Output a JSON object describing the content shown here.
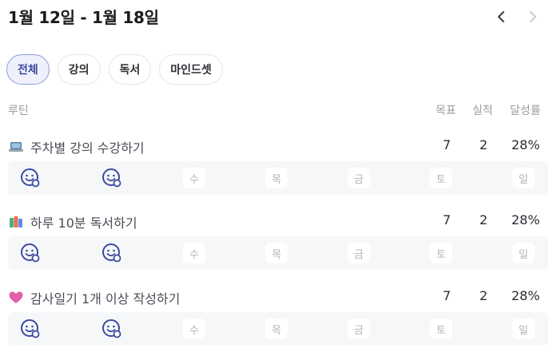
{
  "header": {
    "title": "1월 12일 - 1월 18일"
  },
  "filters": [
    {
      "label": "전체",
      "active": true
    },
    {
      "label": "강의",
      "active": false
    },
    {
      "label": "독서",
      "active": false
    },
    {
      "label": "마인드셋",
      "active": false
    }
  ],
  "columns": {
    "routine": "루틴",
    "goal": "목표",
    "actual": "실적",
    "rate": "달성률"
  },
  "accent_color": "#3b4aa0",
  "routines": [
    {
      "icon": "laptop-icon",
      "name": "주차별 강의 수강하기",
      "goal": "7",
      "actual": "2",
      "rate": "28%",
      "days": [
        "",
        "",
        "수",
        "목",
        "금",
        "토",
        "일"
      ]
    },
    {
      "icon": "books-icon",
      "name": "하루 10분 독서하기",
      "goal": "7",
      "actual": "2",
      "rate": "28%",
      "days": [
        "",
        "",
        "수",
        "목",
        "금",
        "토",
        "일"
      ]
    },
    {
      "icon": "heart-icon",
      "name": "감사일기 1개 이상 작성하기",
      "goal": "7",
      "actual": "2",
      "rate": "28%",
      "days": [
        "",
        "",
        "수",
        "목",
        "금",
        "토",
        "일"
      ]
    }
  ]
}
